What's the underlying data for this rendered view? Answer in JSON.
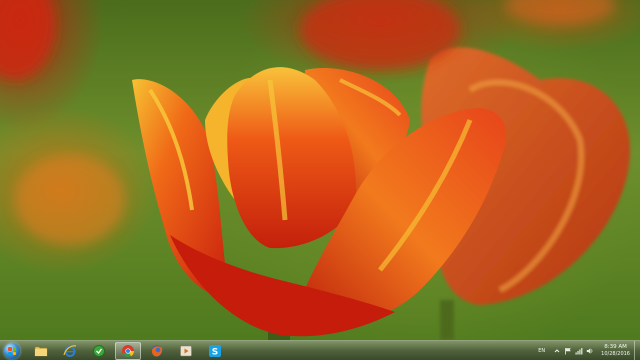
{
  "desktop": {
    "wallpaper": "red-yellow-tulip"
  },
  "taskbar": {
    "start_icon": "windows-orb-icon",
    "pinned": [
      {
        "name": "windows-explorer",
        "icon": "folder-icon"
      },
      {
        "name": "internet-explorer",
        "icon": "ie-icon"
      },
      {
        "name": "utility-app",
        "icon": "green-circle-icon"
      },
      {
        "name": "google-chrome",
        "icon": "chrome-icon",
        "active": true
      },
      {
        "name": "firefox",
        "icon": "firefox-icon"
      },
      {
        "name": "media-player",
        "icon": "media-player-icon"
      },
      {
        "name": "skype",
        "icon": "skype-icon"
      }
    ],
    "tray": {
      "language": "EN",
      "icons": [
        "show-hidden-icons-chevron",
        "flag-icon",
        "network-icon",
        "volume-icon"
      ],
      "time": "8:39 AM",
      "date": "10/28/2016"
    }
  },
  "colors": {
    "taskbar_top": "#788c5a",
    "taskbar_bottom": "#324423",
    "tulip_red": "#d92a10",
    "tulip_yellow": "#f2b01e",
    "background_green": "#5c7f22"
  }
}
